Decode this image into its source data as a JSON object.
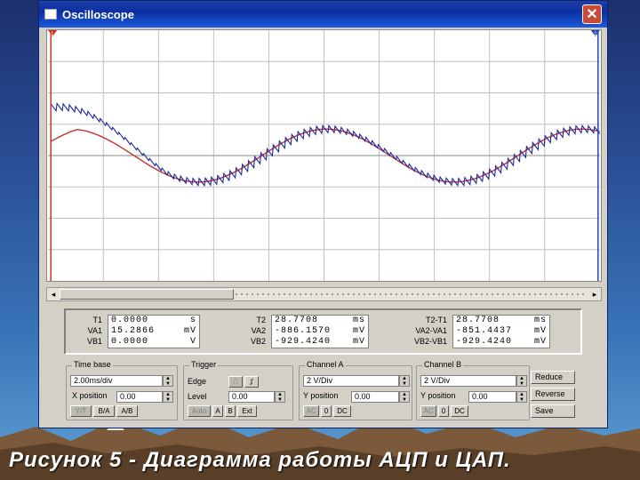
{
  "window": {
    "title": "Oscilloscope",
    "close_glyph": "✕"
  },
  "screen": {
    "colors": {
      "channel_a": "#1a2a9c",
      "channel_b": "#c4302b",
      "grid": "#c0c0c0",
      "cursor1": "#d03020",
      "cursor2": "#2040c0"
    },
    "cursor_labels": {
      "t1": "1",
      "t2": "2"
    }
  },
  "readouts": {
    "t1": {
      "labels": [
        "T1",
        "VA1",
        "VB1"
      ],
      "values": [
        "0.0000",
        "15.2866",
        "0.0000"
      ],
      "units": [
        "s",
        "mV",
        "V"
      ]
    },
    "t2": {
      "labels": [
        "T2",
        "VA2",
        "VB2"
      ],
      "values": [
        "28.7708",
        "-886.1570",
        "-929.4240"
      ],
      "units": [
        "ms",
        "mV",
        "mV"
      ]
    },
    "diff": {
      "labels": [
        "T2-T1",
        "VA2-VA1",
        "VB2-VB1"
      ],
      "values": [
        "28.7708",
        "-851.4437",
        "-929.4240"
      ],
      "units": [
        "ms",
        "mV",
        "mV"
      ]
    }
  },
  "timebase": {
    "title": "Time base",
    "scale": "2.00ms/div",
    "xpos_label": "X position",
    "xpos": "0.00",
    "modes": [
      "Y/T",
      "B/A",
      "A/B"
    ]
  },
  "trigger": {
    "title": "Trigger",
    "edge_label": "Edge",
    "level_label": "Level",
    "level": "0.00",
    "sources": [
      "Auto",
      "A",
      "B",
      "Ext"
    ]
  },
  "channel_a": {
    "title": "Channel A",
    "scale": "2  V/Div",
    "ypos_label": "Y position",
    "ypos": "0.00",
    "coupling": [
      "AC",
      "0",
      "DC"
    ]
  },
  "channel_b": {
    "title": "Channel B",
    "scale": "2  V/Div",
    "ypos_label": "Y position",
    "ypos": "0.00",
    "coupling": [
      "AC",
      "0",
      "DC"
    ]
  },
  "side_buttons": {
    "reduce": "Reduce",
    "reverse": "Reverse",
    "save": "Save"
  },
  "caption": "Рисунок 5 - Диаграмма работы АЦП и ЦАП."
}
